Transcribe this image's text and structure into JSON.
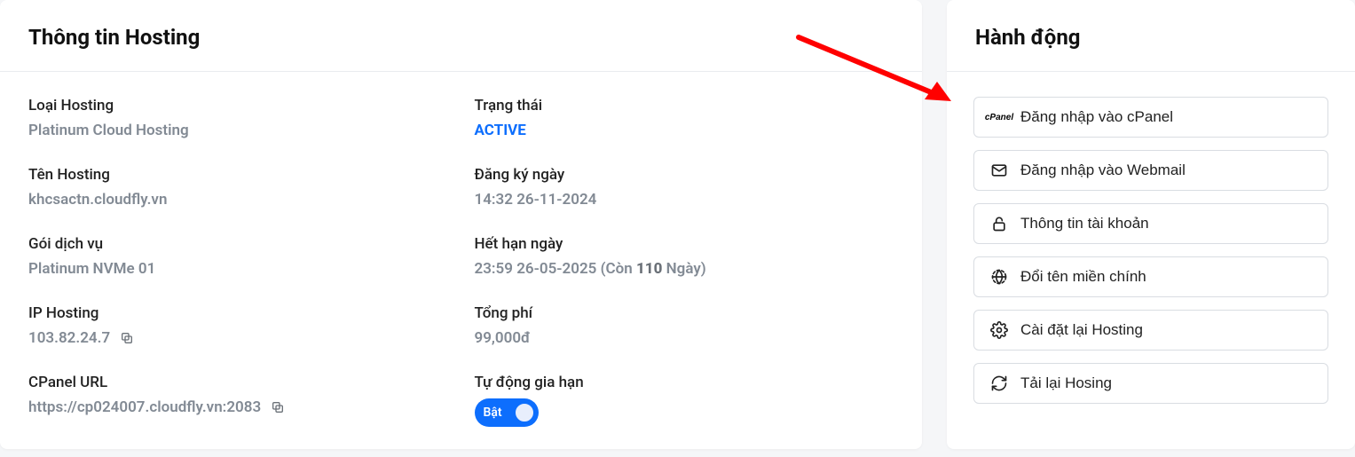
{
  "hosting_info": {
    "title": "Thông tin Hosting",
    "items": {
      "hosting_type": {
        "label": "Loại Hosting",
        "value": "Platinum Cloud Hosting"
      },
      "status": {
        "label": "Trạng thái",
        "value": "ACTIVE"
      },
      "hosting_name": {
        "label": "Tên Hosting",
        "value": "khcsactn.cloudfly.vn"
      },
      "registered": {
        "label": "Đăng ký ngày",
        "value": "14:32 26-11-2024"
      },
      "package": {
        "label": "Gói dịch vụ",
        "value": "Platinum NVMe 01"
      },
      "expires": {
        "label": "Hết hạn ngày",
        "value": "23:59 26-05-2025",
        "suffix_open": "(Còn ",
        "days": "110",
        "days_unit": " Ngày)"
      },
      "ip": {
        "label": "IP Hosting",
        "value": "103.82.24.7"
      },
      "total_fee": {
        "label": "Tổng phí",
        "value": "99,000đ"
      },
      "cpanel_url": {
        "label": "CPanel URL",
        "value": "https://cp024007.cloudfly.vn:2083"
      },
      "auto_renew": {
        "label": "Tự động gia hạn",
        "toggle_label": "Bật"
      }
    }
  },
  "actions": {
    "title": "Hành động",
    "items": [
      {
        "label": "Đăng nhập vào cPanel",
        "icon": "cpanel"
      },
      {
        "label": "Đăng nhập vào Webmail",
        "icon": "mail"
      },
      {
        "label": "Thông tin tài khoản",
        "icon": "lock"
      },
      {
        "label": "Đổi tên miền chính",
        "icon": "globe"
      },
      {
        "label": "Cài đặt lại Hosting",
        "icon": "gear"
      },
      {
        "label": "Tải lại Hosing",
        "icon": "refresh"
      }
    ],
    "cpanel_icon_text": "cPanel"
  }
}
